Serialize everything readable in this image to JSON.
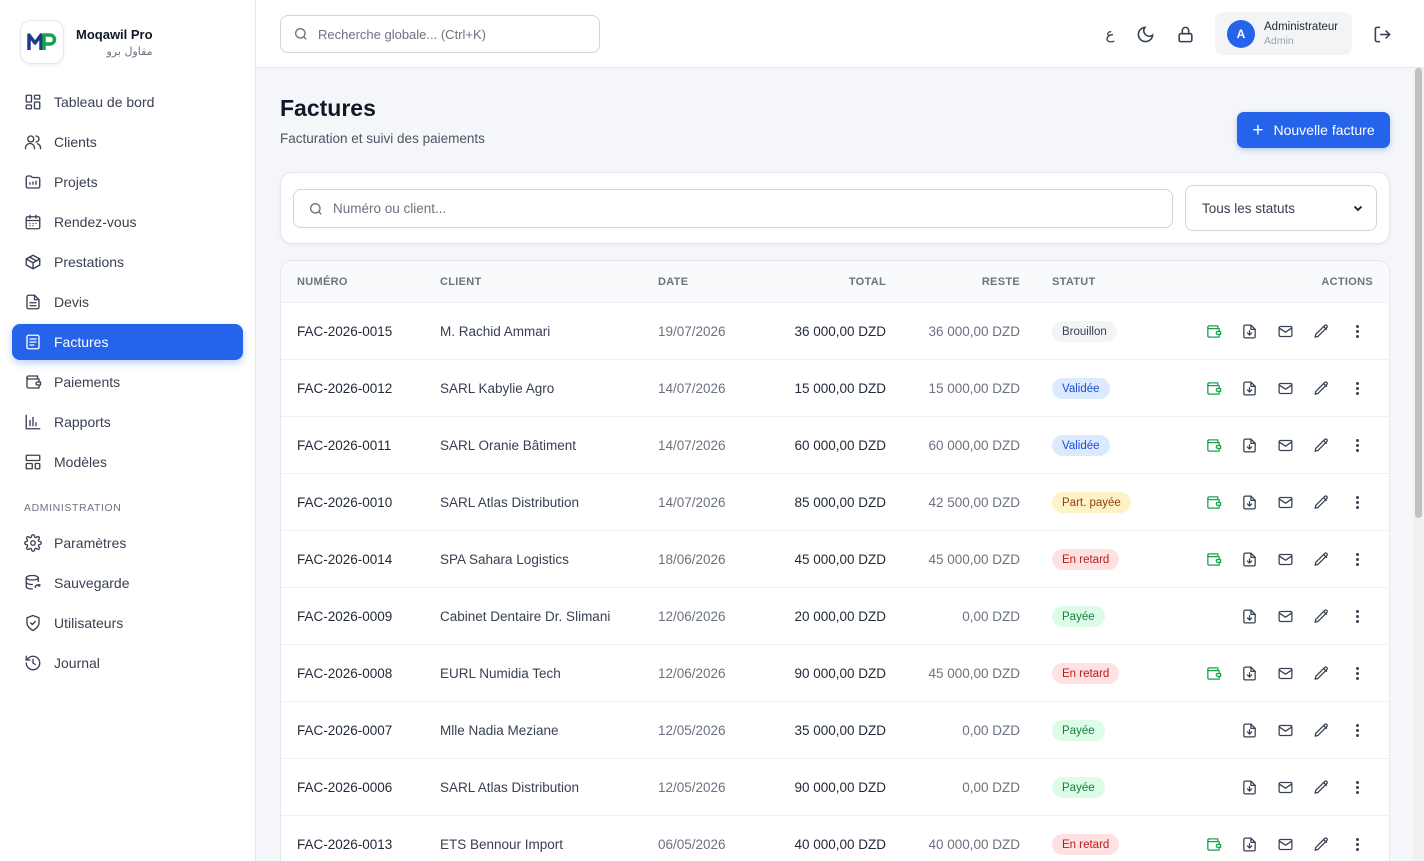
{
  "brand": {
    "name": "Moqawil Pro",
    "subtitle": "مقاول برو",
    "logo_text": "MP"
  },
  "sidebar": {
    "items": [
      {
        "label": "Tableau de bord",
        "icon": "dashboard-icon"
      },
      {
        "label": "Clients",
        "icon": "users-icon"
      },
      {
        "label": "Projets",
        "icon": "folder-icon"
      },
      {
        "label": "Rendez-vous",
        "icon": "calendar-icon"
      },
      {
        "label": "Prestations",
        "icon": "package-icon"
      },
      {
        "label": "Devis",
        "icon": "document-icon"
      },
      {
        "label": "Factures",
        "icon": "invoice-icon",
        "active": true
      },
      {
        "label": "Paiements",
        "icon": "wallet-icon"
      },
      {
        "label": "Rapports",
        "icon": "bar-chart-icon"
      },
      {
        "label": "Modèles",
        "icon": "template-icon"
      }
    ],
    "admin_section": "ADMINISTRATION",
    "admin_items": [
      {
        "label": "Paramètres",
        "icon": "gear-icon"
      },
      {
        "label": "Sauvegarde",
        "icon": "database-icon"
      },
      {
        "label": "Utilisateurs",
        "icon": "shield-icon"
      },
      {
        "label": "Journal",
        "icon": "history-icon"
      }
    ]
  },
  "topbar": {
    "search_placeholder": "Recherche globale... (Ctrl+K)",
    "lang_glyph": "ع",
    "user": {
      "initial": "A",
      "name": "Administrateur",
      "role": "Admin"
    }
  },
  "page": {
    "title": "Factures",
    "subtitle": "Facturation et suivi des paiements",
    "new_button": "Nouvelle facture"
  },
  "filters": {
    "search_placeholder": "Numéro ou client...",
    "status_selected": "Tous les statuts"
  },
  "table": {
    "headers": {
      "number": "NUMÉRO",
      "client": "CLIENT",
      "date": "DATE",
      "total": "TOTAL",
      "reste": "RESTE",
      "status": "STATUT",
      "actions": "ACTIONS"
    },
    "rows": [
      {
        "number": "FAC-2026-0015",
        "client": "M. Rachid Ammari",
        "date": "19/07/2026",
        "total": "36 000,00 DZD",
        "reste": "36 000,00 DZD",
        "status": "Brouillon",
        "status_kind": "draft",
        "payable": true
      },
      {
        "number": "FAC-2026-0012",
        "client": "SARL Kabylie Agro",
        "date": "14/07/2026",
        "total": "15 000,00 DZD",
        "reste": "15 000,00 DZD",
        "status": "Validée",
        "status_kind": "validated",
        "payable": true
      },
      {
        "number": "FAC-2026-0011",
        "client": "SARL Oranie Bâtiment",
        "date": "14/07/2026",
        "total": "60 000,00 DZD",
        "reste": "60 000,00 DZD",
        "status": "Validée",
        "status_kind": "validated",
        "payable": true
      },
      {
        "number": "FAC-2026-0010",
        "client": "SARL Atlas Distribution",
        "date": "14/07/2026",
        "total": "85 000,00 DZD",
        "reste": "42 500,00 DZD",
        "status": "Part. payée",
        "status_kind": "partial",
        "payable": true
      },
      {
        "number": "FAC-2026-0014",
        "client": "SPA Sahara Logistics",
        "date": "18/06/2026",
        "total": "45 000,00 DZD",
        "reste": "45 000,00 DZD",
        "status": "En retard",
        "status_kind": "late",
        "payable": true
      },
      {
        "number": "FAC-2026-0009",
        "client": "Cabinet Dentaire Dr. Slimani",
        "date": "12/06/2026",
        "total": "20 000,00 DZD",
        "reste": "0,00 DZD",
        "status": "Payée",
        "status_kind": "paid",
        "payable": false
      },
      {
        "number": "FAC-2026-0008",
        "client": "EURL Numidia Tech",
        "date": "12/06/2026",
        "total": "90 000,00 DZD",
        "reste": "45 000,00 DZD",
        "status": "En retard",
        "status_kind": "late",
        "payable": true
      },
      {
        "number": "FAC-2026-0007",
        "client": "Mlle Nadia Meziane",
        "date": "12/05/2026",
        "total": "35 000,00 DZD",
        "reste": "0,00 DZD",
        "status": "Payée",
        "status_kind": "paid",
        "payable": false
      },
      {
        "number": "FAC-2026-0006",
        "client": "SARL Atlas Distribution",
        "date": "12/05/2026",
        "total": "90 000,00 DZD",
        "reste": "0,00 DZD",
        "status": "Payée",
        "status_kind": "paid",
        "payable": false
      },
      {
        "number": "FAC-2026-0013",
        "client": "ETS Bennour Import",
        "date": "06/05/2026",
        "total": "40 000,00 DZD",
        "reste": "40 000,00 DZD",
        "status": "En retard",
        "status_kind": "late",
        "payable": true
      }
    ]
  },
  "colors": {
    "accent": "#2563eb",
    "draft_bg": "#f3f4f6",
    "draft_fg": "#374151",
    "validated_bg": "#dbeafe",
    "validated_fg": "#1d4ed8",
    "partial_bg": "#fef3c7",
    "partial_fg": "#92400e",
    "late_bg": "#fee2e2",
    "late_fg": "#b91c1c",
    "paid_bg": "#dcfce7",
    "paid_fg": "#15803d"
  }
}
